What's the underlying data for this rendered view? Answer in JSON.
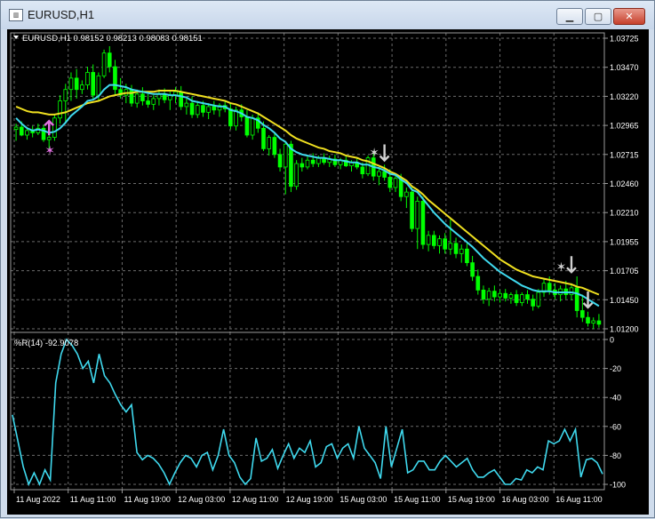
{
  "window": {
    "title": "EURUSD,H1",
    "icon": "chart-window-icon",
    "buttons": {
      "minimize": "minimize-icon",
      "maximize": "maximize-icon",
      "close": "close-icon"
    }
  },
  "colors": {
    "background": "#000000",
    "grid": "#6b6b6b",
    "text": "#ffffff",
    "bull": "#00ff00",
    "bear": "#000000",
    "ma_fast": "#3fd9ee",
    "ma_slow": "#f0e020",
    "wpr_line": "#3fd9ee",
    "arrow_up": "#e070e0",
    "arrow_down": "#d0d0d0"
  },
  "main_panel": {
    "header_text": "EURUSD,H1  0.98152 0.98213 0.98083 0.98151",
    "y_labels": [
      "1.03725",
      "1.03470",
      "1.03220",
      "1.02965",
      "1.02715",
      "1.02460",
      "1.02210",
      "1.01955",
      "1.01705",
      "1.01450",
      "1.01200"
    ]
  },
  "indicator_panel": {
    "header_text": "%R(14) -92.9078",
    "y_labels": [
      "0",
      "-20",
      "-40",
      "-60",
      "-80",
      "-100"
    ]
  },
  "x_labels": [
    "11 Aug 2022",
    "11 Aug 11:00",
    "11 Aug 19:00",
    "12 Aug 03:00",
    "12 Aug 11:00",
    "12 Aug 19:00",
    "15 Aug 03:00",
    "15 Aug 11:00",
    "15 Aug 19:00",
    "16 Aug 03:00",
    "16 Aug 11:00"
  ],
  "chart_data": [
    {
      "type": "candlestick",
      "title": "EURUSD,H1",
      "ylim": [
        1.012,
        1.0375
      ],
      "grid": true,
      "candles": [
        {
          "o": 1.0295,
          "h": 1.03,
          "l": 1.0285,
          "c": 1.0297
        },
        {
          "o": 1.0297,
          "h": 1.0302,
          "l": 1.0289,
          "c": 1.029
        },
        {
          "o": 1.029,
          "h": 1.0297,
          "l": 1.0286,
          "c": 1.0294
        },
        {
          "o": 1.0294,
          "h": 1.0298,
          "l": 1.0288,
          "c": 1.0292
        },
        {
          "o": 1.0292,
          "h": 1.03,
          "l": 1.029,
          "c": 1.0296
        },
        {
          "o": 1.0296,
          "h": 1.0299,
          "l": 1.0284,
          "c": 1.0286
        },
        {
          "o": 1.0286,
          "h": 1.0292,
          "l": 1.0278,
          "c": 1.0288
        },
        {
          "o": 1.0288,
          "h": 1.0308,
          "l": 1.0285,
          "c": 1.0305
        },
        {
          "o": 1.0305,
          "h": 1.0325,
          "l": 1.03,
          "c": 1.032
        },
        {
          "o": 1.032,
          "h": 1.0335,
          "l": 1.03,
          "c": 1.033
        },
        {
          "o": 1.033,
          "h": 1.0345,
          "l": 1.032,
          "c": 1.034
        },
        {
          "o": 1.034,
          "h": 1.0348,
          "l": 1.0322,
          "c": 1.033
        },
        {
          "o": 1.033,
          "h": 1.0338,
          "l": 1.0326,
          "c": 1.0334
        },
        {
          "o": 1.0334,
          "h": 1.035,
          "l": 1.033,
          "c": 1.0345
        },
        {
          "o": 1.0345,
          "h": 1.0352,
          "l": 1.0322,
          "c": 1.0325
        },
        {
          "o": 1.0325,
          "h": 1.0345,
          "l": 1.032,
          "c": 1.0342
        },
        {
          "o": 1.0342,
          "h": 1.0365,
          "l": 1.034,
          "c": 1.0362
        },
        {
          "o": 1.0362,
          "h": 1.0368,
          "l": 1.0345,
          "c": 1.035
        },
        {
          "o": 1.035,
          "h": 1.0356,
          "l": 1.0325,
          "c": 1.033
        },
        {
          "o": 1.033,
          "h": 1.034,
          "l": 1.0322,
          "c": 1.0325
        },
        {
          "o": 1.0325,
          "h": 1.0335,
          "l": 1.0318,
          "c": 1.033
        },
        {
          "o": 1.033,
          "h": 1.0334,
          "l": 1.0315,
          "c": 1.0318
        },
        {
          "o": 1.0318,
          "h": 1.033,
          "l": 1.0314,
          "c": 1.0326
        },
        {
          "o": 1.0326,
          "h": 1.0332,
          "l": 1.0316,
          "c": 1.032
        },
        {
          "o": 1.032,
          "h": 1.0326,
          "l": 1.0314,
          "c": 1.0317
        },
        {
          "o": 1.0317,
          "h": 1.0325,
          "l": 1.0312,
          "c": 1.0322
        },
        {
          "o": 1.0322,
          "h": 1.033,
          "l": 1.0316,
          "c": 1.0326
        },
        {
          "o": 1.0326,
          "h": 1.0331,
          "l": 1.0318,
          "c": 1.0321
        },
        {
          "o": 1.0321,
          "h": 1.0328,
          "l": 1.0312,
          "c": 1.0325
        },
        {
          "o": 1.0325,
          "h": 1.0332,
          "l": 1.0318,
          "c": 1.0328
        },
        {
          "o": 1.0328,
          "h": 1.0333,
          "l": 1.0312,
          "c": 1.0315
        },
        {
          "o": 1.0315,
          "h": 1.0322,
          "l": 1.0308,
          "c": 1.0318
        },
        {
          "o": 1.0318,
          "h": 1.0324,
          "l": 1.0305,
          "c": 1.0308
        },
        {
          "o": 1.0308,
          "h": 1.032,
          "l": 1.0305,
          "c": 1.0316
        },
        {
          "o": 1.0316,
          "h": 1.032,
          "l": 1.0306,
          "c": 1.031
        },
        {
          "o": 1.031,
          "h": 1.0318,
          "l": 1.0304,
          "c": 1.0315
        },
        {
          "o": 1.0315,
          "h": 1.032,
          "l": 1.0308,
          "c": 1.0312
        },
        {
          "o": 1.0312,
          "h": 1.0318,
          "l": 1.0306,
          "c": 1.0316
        },
        {
          "o": 1.0316,
          "h": 1.032,
          "l": 1.031,
          "c": 1.0313
        },
        {
          "o": 1.0313,
          "h": 1.0318,
          "l": 1.0295,
          "c": 1.0298
        },
        {
          "o": 1.0298,
          "h": 1.0315,
          "l": 1.0294,
          "c": 1.0312
        },
        {
          "o": 1.0312,
          "h": 1.0317,
          "l": 1.0302,
          "c": 1.0306
        },
        {
          "o": 1.0306,
          "h": 1.0312,
          "l": 1.0288,
          "c": 1.029
        },
        {
          "o": 1.029,
          "h": 1.0308,
          "l": 1.0286,
          "c": 1.0305
        },
        {
          "o": 1.0305,
          "h": 1.031,
          "l": 1.0292,
          "c": 1.0296
        },
        {
          "o": 1.0296,
          "h": 1.0302,
          "l": 1.0276,
          "c": 1.0278
        },
        {
          "o": 1.0278,
          "h": 1.029,
          "l": 1.0272,
          "c": 1.0288
        },
        {
          "o": 1.0288,
          "h": 1.0292,
          "l": 1.027,
          "c": 1.0273
        },
        {
          "o": 1.0273,
          "h": 1.0278,
          "l": 1.0258,
          "c": 1.0262
        },
        {
          "o": 1.0262,
          "h": 1.0285,
          "l": 1.0238,
          "c": 1.0282
        },
        {
          "o": 1.0282,
          "h": 1.0285,
          "l": 1.024,
          "c": 1.0245
        },
        {
          "o": 1.0245,
          "h": 1.0268,
          "l": 1.0242,
          "c": 1.0265
        },
        {
          "o": 1.0265,
          "h": 1.027,
          "l": 1.0258,
          "c": 1.0262
        },
        {
          "o": 1.0262,
          "h": 1.0272,
          "l": 1.026,
          "c": 1.0268
        },
        {
          "o": 1.0268,
          "h": 1.0274,
          "l": 1.0262,
          "c": 1.0265
        },
        {
          "o": 1.0265,
          "h": 1.0272,
          "l": 1.0262,
          "c": 1.027
        },
        {
          "o": 1.027,
          "h": 1.0274,
          "l": 1.0264,
          "c": 1.0266
        },
        {
          "o": 1.0266,
          "h": 1.0272,
          "l": 1.0262,
          "c": 1.0269
        },
        {
          "o": 1.0269,
          "h": 1.0273,
          "l": 1.0262,
          "c": 1.0264
        },
        {
          "o": 1.0264,
          "h": 1.027,
          "l": 1.026,
          "c": 1.0268
        },
        {
          "o": 1.0268,
          "h": 1.0272,
          "l": 1.0262,
          "c": 1.0263
        },
        {
          "o": 1.0263,
          "h": 1.0268,
          "l": 1.0258,
          "c": 1.0266
        },
        {
          "o": 1.0266,
          "h": 1.027,
          "l": 1.026,
          "c": 1.0262
        },
        {
          "o": 1.0262,
          "h": 1.0266,
          "l": 1.0252,
          "c": 1.0256
        },
        {
          "o": 1.0256,
          "h": 1.0272,
          "l": 1.0254,
          "c": 1.027
        },
        {
          "o": 1.027,
          "h": 1.0276,
          "l": 1.025,
          "c": 1.0254
        },
        {
          "o": 1.0254,
          "h": 1.0262,
          "l": 1.0246,
          "c": 1.0258
        },
        {
          "o": 1.0258,
          "h": 1.0264,
          "l": 1.025,
          "c": 1.0253
        },
        {
          "o": 1.0253,
          "h": 1.026,
          "l": 1.024,
          "c": 1.0244
        },
        {
          "o": 1.0244,
          "h": 1.0256,
          "l": 1.024,
          "c": 1.0252
        },
        {
          "o": 1.0252,
          "h": 1.0256,
          "l": 1.0232,
          "c": 1.0236
        },
        {
          "o": 1.0236,
          "h": 1.0244,
          "l": 1.0226,
          "c": 1.024
        },
        {
          "o": 1.024,
          "h": 1.0244,
          "l": 1.0205,
          "c": 1.0208
        },
        {
          "o": 1.0208,
          "h": 1.0236,
          "l": 1.019,
          "c": 1.0232
        },
        {
          "o": 1.0232,
          "h": 1.0236,
          "l": 1.019,
          "c": 1.0194
        },
        {
          "o": 1.0194,
          "h": 1.0206,
          "l": 1.0188,
          "c": 1.0202
        },
        {
          "o": 1.0202,
          "h": 1.0206,
          "l": 1.019,
          "c": 1.0193
        },
        {
          "o": 1.0193,
          "h": 1.0202,
          "l": 1.0186,
          "c": 1.0199
        },
        {
          "o": 1.0199,
          "h": 1.0204,
          "l": 1.0186,
          "c": 1.019
        },
        {
          "o": 1.019,
          "h": 1.0216,
          "l": 1.0185,
          "c": 1.0195
        },
        {
          "o": 1.0195,
          "h": 1.02,
          "l": 1.0182,
          "c": 1.0186
        },
        {
          "o": 1.0186,
          "h": 1.0194,
          "l": 1.0178,
          "c": 1.019
        },
        {
          "o": 1.019,
          "h": 1.0195,
          "l": 1.0175,
          "c": 1.0178
        },
        {
          "o": 1.0178,
          "h": 1.0184,
          "l": 1.0162,
          "c": 1.0166
        },
        {
          "o": 1.0166,
          "h": 1.0172,
          "l": 1.015,
          "c": 1.0154
        },
        {
          "o": 1.0154,
          "h": 1.0158,
          "l": 1.0142,
          "c": 1.0146
        },
        {
          "o": 1.0146,
          "h": 1.0156,
          "l": 1.014,
          "c": 1.0153
        },
        {
          "o": 1.0153,
          "h": 1.0158,
          "l": 1.0144,
          "c": 1.0148
        },
        {
          "o": 1.0148,
          "h": 1.0154,
          "l": 1.0143,
          "c": 1.0151
        },
        {
          "o": 1.0151,
          "h": 1.0155,
          "l": 1.0144,
          "c": 1.0147
        },
        {
          "o": 1.0147,
          "h": 1.0152,
          "l": 1.0142,
          "c": 1.015
        },
        {
          "o": 1.015,
          "h": 1.0154,
          "l": 1.014,
          "c": 1.0143
        },
        {
          "o": 1.0143,
          "h": 1.0152,
          "l": 1.014,
          "c": 1.015
        },
        {
          "o": 1.015,
          "h": 1.0154,
          "l": 1.0142,
          "c": 1.0146
        },
        {
          "o": 1.0146,
          "h": 1.015,
          "l": 1.0136,
          "c": 1.014
        },
        {
          "o": 1.014,
          "h": 1.0155,
          "l": 1.0138,
          "c": 1.0152
        },
        {
          "o": 1.0152,
          "h": 1.0164,
          "l": 1.0148,
          "c": 1.016
        },
        {
          "o": 1.016,
          "h": 1.0166,
          "l": 1.015,
          "c": 1.0154
        },
        {
          "o": 1.0154,
          "h": 1.016,
          "l": 1.0146,
          "c": 1.015
        },
        {
          "o": 1.015,
          "h": 1.0158,
          "l": 1.0144,
          "c": 1.0155
        },
        {
          "o": 1.0155,
          "h": 1.0162,
          "l": 1.0146,
          "c": 1.015
        },
        {
          "o": 1.015,
          "h": 1.016,
          "l": 1.0145,
          "c": 1.0156
        },
        {
          "o": 1.0156,
          "h": 1.0166,
          "l": 1.013,
          "c": 1.0136
        },
        {
          "o": 1.0136,
          "h": 1.015,
          "l": 1.0126,
          "c": 1.013
        },
        {
          "o": 1.013,
          "h": 1.0135,
          "l": 1.0122,
          "c": 1.0125
        },
        {
          "o": 1.0125,
          "h": 1.013,
          "l": 1.012,
          "c": 1.0127
        },
        {
          "o": 1.0127,
          "h": 1.0133,
          "l": 1.0121,
          "c": 1.0124
        }
      ],
      "ma_fast": [
        1.0305,
        1.03,
        1.0296,
        1.0294,
        1.0295,
        1.0294,
        1.0292,
        1.0293,
        1.0296,
        1.0301,
        1.0307,
        1.0311,
        1.0315,
        1.032,
        1.0321,
        1.0324,
        1.033,
        1.0334,
        1.0334,
        1.0333,
        1.0332,
        1.033,
        1.0329,
        1.0328,
        1.0327,
        1.0326,
        1.0326,
        1.0326,
        1.0325,
        1.0325,
        1.0324,
        1.0323,
        1.032,
        1.0319,
        1.0318,
        1.0317,
        1.0316,
        1.0315,
        1.0315,
        1.0312,
        1.0311,
        1.0309,
        1.0306,
        1.0305,
        1.0303,
        1.0299,
        1.0296,
        1.0292,
        1.0287,
        1.0284,
        1.0278,
        1.0275,
        1.0273,
        1.0272,
        1.0271,
        1.027,
        1.027,
        1.0269,
        1.0268,
        1.0268,
        1.0267,
        1.0266,
        1.0266,
        1.0264,
        1.0264,
        1.0262,
        1.0261,
        1.0259,
        1.0256,
        1.0255,
        1.0251,
        1.0248,
        1.0242,
        1.024,
        1.0234,
        1.0228,
        1.0222,
        1.0217,
        1.0212,
        1.0208,
        1.0204,
        1.02,
        1.0196,
        1.0192,
        1.0187,
        1.0182,
        1.0178,
        1.0174,
        1.017,
        1.0167,
        1.0164,
        1.0161,
        1.0158,
        1.0156,
        1.0154,
        1.0153,
        1.0153,
        1.0153,
        1.0152,
        1.0152,
        1.0152,
        1.0152,
        1.0151,
        1.0149,
        1.0146,
        1.0143,
        1.014
      ],
      "ma_slow": [
        1.0315,
        1.0313,
        1.0311,
        1.031,
        1.031,
        1.0309,
        1.0308,
        1.0308,
        1.0309,
        1.031,
        1.0312,
        1.0314,
        1.0316,
        1.0318,
        1.0319,
        1.032,
        1.0322,
        1.0324,
        1.0325,
        1.0326,
        1.0327,
        1.0327,
        1.0328,
        1.0328,
        1.0328,
        1.0328,
        1.0329,
        1.0329,
        1.0329,
        1.0329,
        1.0328,
        1.0327,
        1.0326,
        1.0325,
        1.0324,
        1.0323,
        1.0322,
        1.0321,
        1.032,
        1.0318,
        1.0317,
        1.0315,
        1.0313,
        1.0311,
        1.0309,
        1.0306,
        1.0303,
        1.03,
        1.0297,
        1.0294,
        1.029,
        1.0287,
        1.0285,
        1.0283,
        1.0281,
        1.0279,
        1.0278,
        1.0276,
        1.0275,
        1.0274,
        1.0272,
        1.0271,
        1.027,
        1.0268,
        1.0267,
        1.0265,
        1.0263,
        1.0261,
        1.0258,
        1.0256,
        1.0253,
        1.025,
        1.0245,
        1.0242,
        1.0238,
        1.0233,
        1.0229,
        1.0225,
        1.0221,
        1.0217,
        1.0213,
        1.0209,
        1.0205,
        1.0201,
        1.0197,
        1.0193,
        1.0189,
        1.0185,
        1.0181,
        1.0178,
        1.0175,
        1.0172,
        1.017,
        1.0168,
        1.0166,
        1.0165,
        1.0164,
        1.0163,
        1.0162,
        1.0161,
        1.016,
        1.0159,
        1.0157,
        1.0156,
        1.0154,
        1.0152,
        1.015
      ],
      "arrows": [
        {
          "candle": 6,
          "direction": "up",
          "price": 1.0293
        },
        {
          "candle": 6,
          "direction": "up-star",
          "price": 1.0276
        },
        {
          "candle": 65,
          "direction": "down-star",
          "price": 1.0274
        },
        {
          "candle": 67,
          "direction": "down",
          "price": 1.0274
        },
        {
          "candle": 99,
          "direction": "down-star",
          "price": 1.0174
        },
        {
          "candle": 101,
          "direction": "down",
          "price": 1.0176
        },
        {
          "candle": 104,
          "direction": "down",
          "price": 1.0145
        }
      ]
    },
    {
      "type": "line",
      "title": "%R(14)",
      "ylim": [
        -100,
        0
      ],
      "series": [
        {
          "name": "%R(14)",
          "values": [
            -52,
            -70,
            -88,
            -100,
            -92,
            -100,
            -90,
            -97,
            -30,
            -10,
            0,
            -4,
            -10,
            -20,
            -15,
            -30,
            -10,
            -25,
            -30,
            -38,
            -45,
            -50,
            -45,
            -78,
            -83,
            -80,
            -82,
            -86,
            -92,
            -100,
            -92,
            -85,
            -80,
            -82,
            -88,
            -80,
            -78,
            -90,
            -80,
            -62,
            -80,
            -85,
            -95,
            -100,
            -96,
            -68,
            -84,
            -82,
            -76,
            -89,
            -80,
            -72,
            -82,
            -75,
            -78,
            -70,
            -88,
            -85,
            -74,
            -72,
            -82,
            -75,
            -72,
            -82,
            -60,
            -75,
            -80,
            -85,
            -96,
            -60,
            -88,
            -75,
            -62,
            -92,
            -90,
            -84,
            -84,
            -90,
            -90,
            -84,
            -80,
            -84,
            -88,
            -85,
            -82,
            -90,
            -95,
            -95,
            -92,
            -90,
            -95,
            -100,
            -100,
            -96,
            -97,
            -90,
            -92,
            -88,
            -90,
            -70,
            -72,
            -70,
            -62,
            -70,
            -62,
            -95,
            -83,
            -82,
            -85,
            -92.9
          ]
        }
      ]
    }
  ]
}
